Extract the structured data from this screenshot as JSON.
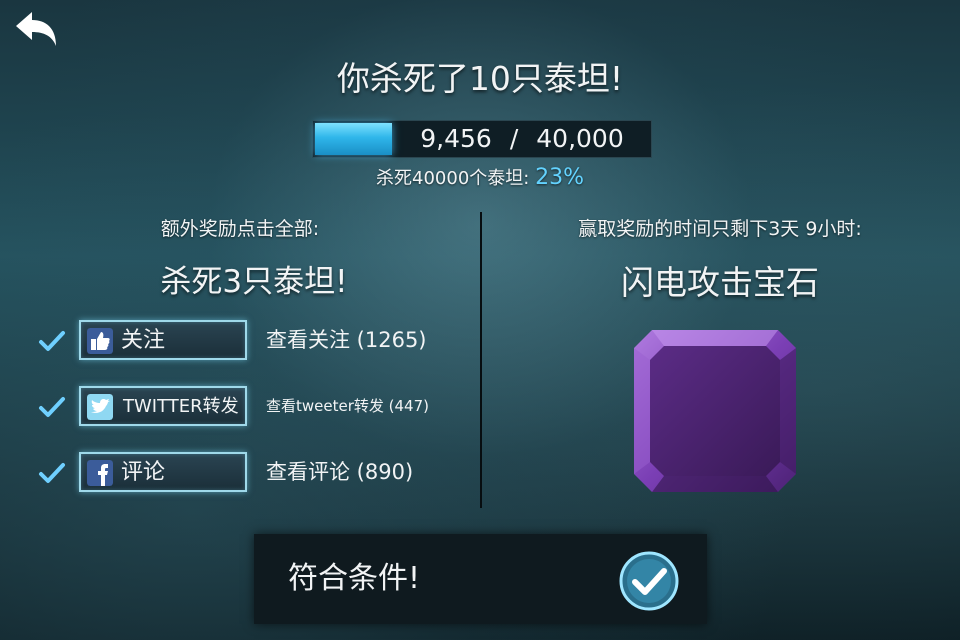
{
  "header": {
    "back_icon": "back-arrow-icon",
    "title": "你杀死了10只泰坦!"
  },
  "progress": {
    "current": "9,456",
    "separator": "/",
    "total": "40,000",
    "fraction": 0.23,
    "fill_color": "#2fb6ea"
  },
  "goal": {
    "label": "杀死40000个泰坦:",
    "percent": "23%",
    "percent_color": "#63d3ff"
  },
  "left": {
    "heading": "额外奖励点击全部:",
    "objective": "杀死3只泰坦!",
    "tasks": [
      {
        "button_label": "关注",
        "icon": "thumbs-up-icon",
        "link": "查看关注 (1265)",
        "completed": true
      },
      {
        "button_label": "TWITTER转发",
        "icon": "twitter-bird-icon",
        "link": "查看tweeter转发 (447)",
        "completed": true
      },
      {
        "button_label": "评论",
        "icon": "facebook-icon",
        "link": "查看评论 (890)",
        "completed": true
      }
    ]
  },
  "right": {
    "heading": "赢取奖励的时间只剩下3天 9小时:",
    "reward_name": "闪电攻击宝石",
    "reward_icon": "purple-gem-icon"
  },
  "footer": {
    "label": "符合条件!",
    "check_icon": "check-circle-icon"
  }
}
